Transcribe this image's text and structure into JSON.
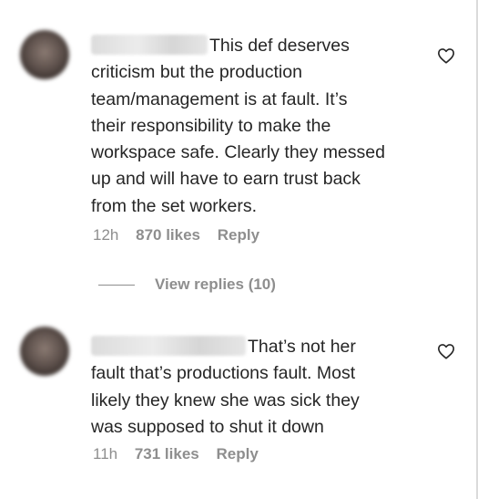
{
  "comments": [
    {
      "text_lines": [
        "This def deserves",
        "criticism but the production",
        "team/management is at fault. It’s",
        "their responsibility to make the",
        "workspace safe. Clearly they messed",
        "up and will have to earn trust back",
        "from the set workers."
      ],
      "time": "12h",
      "likes": "870 likes",
      "reply_label": "Reply",
      "liked": false,
      "icon": "heart-outline"
    },
    {
      "text_lines": [
        "That’s not her",
        "fault that’s productions fault. Most",
        "likely they knew she was sick they",
        "was supposed to shut it down"
      ],
      "time": "11h",
      "likes": "731 likes",
      "reply_label": "Reply",
      "liked": false,
      "icon": "heart-outline"
    }
  ],
  "view_replies": "View replies (10)",
  "colors": {
    "text": "#262626",
    "secondary": "#8e8e8e",
    "background": "#ffffff"
  }
}
